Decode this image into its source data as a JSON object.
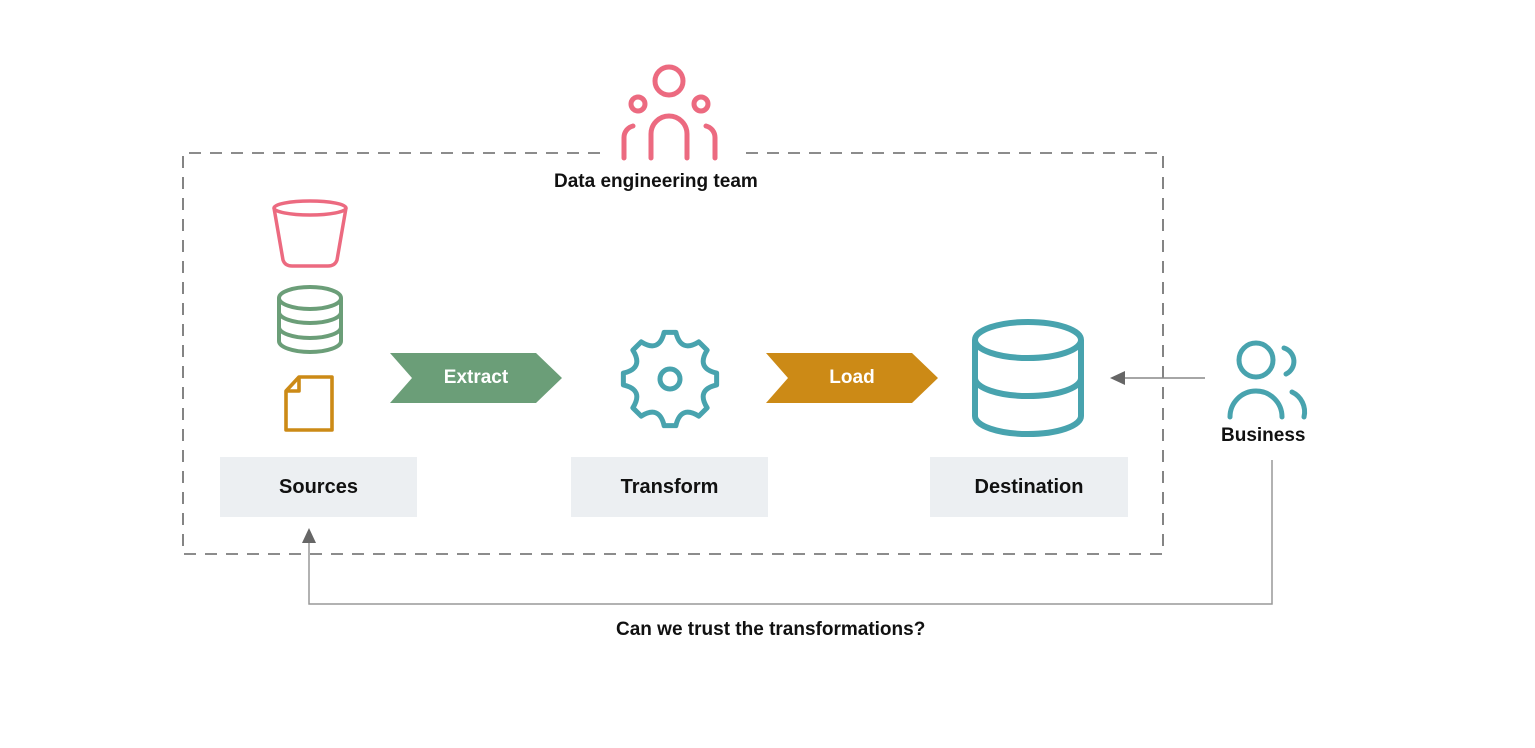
{
  "diagram": {
    "team": {
      "label": "Data engineering team",
      "icon": "team-icon",
      "color": "#ec6a80"
    },
    "stages": [
      {
        "id": "sources",
        "label": "Sources"
      },
      {
        "id": "transform",
        "label": "Transform"
      },
      {
        "id": "destination",
        "label": "Destination"
      }
    ],
    "source_icons": [
      {
        "icon": "bucket-icon",
        "color": "#ec6a80"
      },
      {
        "icon": "database-icon",
        "color": "#6b9e78"
      },
      {
        "icon": "file-icon",
        "color": "#cc8a16"
      }
    ],
    "steps": [
      {
        "label": "Extract",
        "color": "#6b9e78"
      },
      {
        "label": "Load",
        "color": "#cc8a16"
      }
    ],
    "transform_icon": {
      "icon": "gear-icon",
      "color": "#48a3ae"
    },
    "destination_icon": {
      "icon": "database-icon",
      "color": "#48a3ae"
    },
    "business": {
      "label": "Business",
      "icon": "users-icon",
      "color": "#48a3ae"
    },
    "question": "Can we trust the transformations?"
  }
}
